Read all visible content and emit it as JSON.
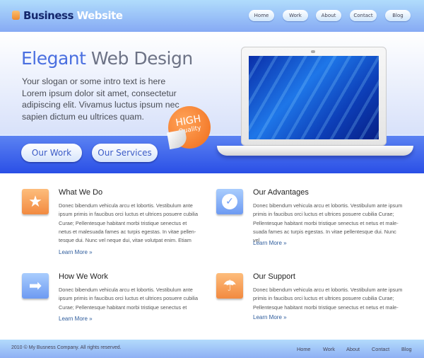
{
  "header": {
    "logo_part1": "Business",
    "logo_part2": "Website",
    "nav": [
      "Home",
      "Work",
      "About",
      "Contact",
      "Blog"
    ]
  },
  "hero": {
    "title_part1": "Elegant",
    "title_part2": "Web Design",
    "intro": "Your slogan or some intro text is here Lorem ipsum dolor sit amet, consectetur adipiscing elit. Vivamus luctus ipsum nec sapien dictum eu ultrices quam.",
    "buttons": [
      "Our Work",
      "Our Services"
    ],
    "badge_line1": "HIGH",
    "badge_line2": "Quality"
  },
  "sections": [
    {
      "title": "What We Do",
      "icon": "star-icon",
      "text": "Donec bibendum vehicula arcu et lobortis. Vestibulum ante ipsum primis in faucibus orci luctus et ultrices posuere cubilia Curae; Pellentesque habitant morbi tristique senectus et netus et malesuada fames ac turpis egestas. In vitae pellen-tesque dui. Nunc vel neque dui, vitae volutpat enim. Etiam",
      "link": "Learn More »"
    },
    {
      "title": "Our Advantages",
      "icon": "check-icon",
      "text": "Donec bibendum vehicula arcu et lobortis. Vestibulum ante ipsum primis in faucibus orci luctus et ultrices posuere cubilia Curae; Pellentesque habitant morbi tristique senectus et netus et male-suada fames ac turpis egestas. In vitae pellentesque dui. Nunc vel",
      "link": "Learn More »"
    },
    {
      "title": "How We Work",
      "icon": "arrow-right-icon",
      "text": "Donec bibendum vehicula arcu et lobortis. Vestibulum ante ipsum primis in faucibus orci luctus et ultrices posuere cubilia Curae; Pellentesque habitant morbi tristique senectus et",
      "link": "Learn More »"
    },
    {
      "title": "Our Support",
      "icon": "umbrella-icon",
      "text": "Donec bibendum vehicula arcu et lobortis. Vestibulum ante ipsum primis in faucibus orci luctus et ultrices posuere cubilia Curae; Pellentesque habitant morbi tristique senectus et netus et male-",
      "link": "Learn More »"
    }
  ],
  "footer": {
    "copyright": "2010 © My Busness Company. All rights reserved.",
    "nav": [
      "Home",
      "Work",
      "About",
      "Contact",
      "Blog"
    ]
  }
}
